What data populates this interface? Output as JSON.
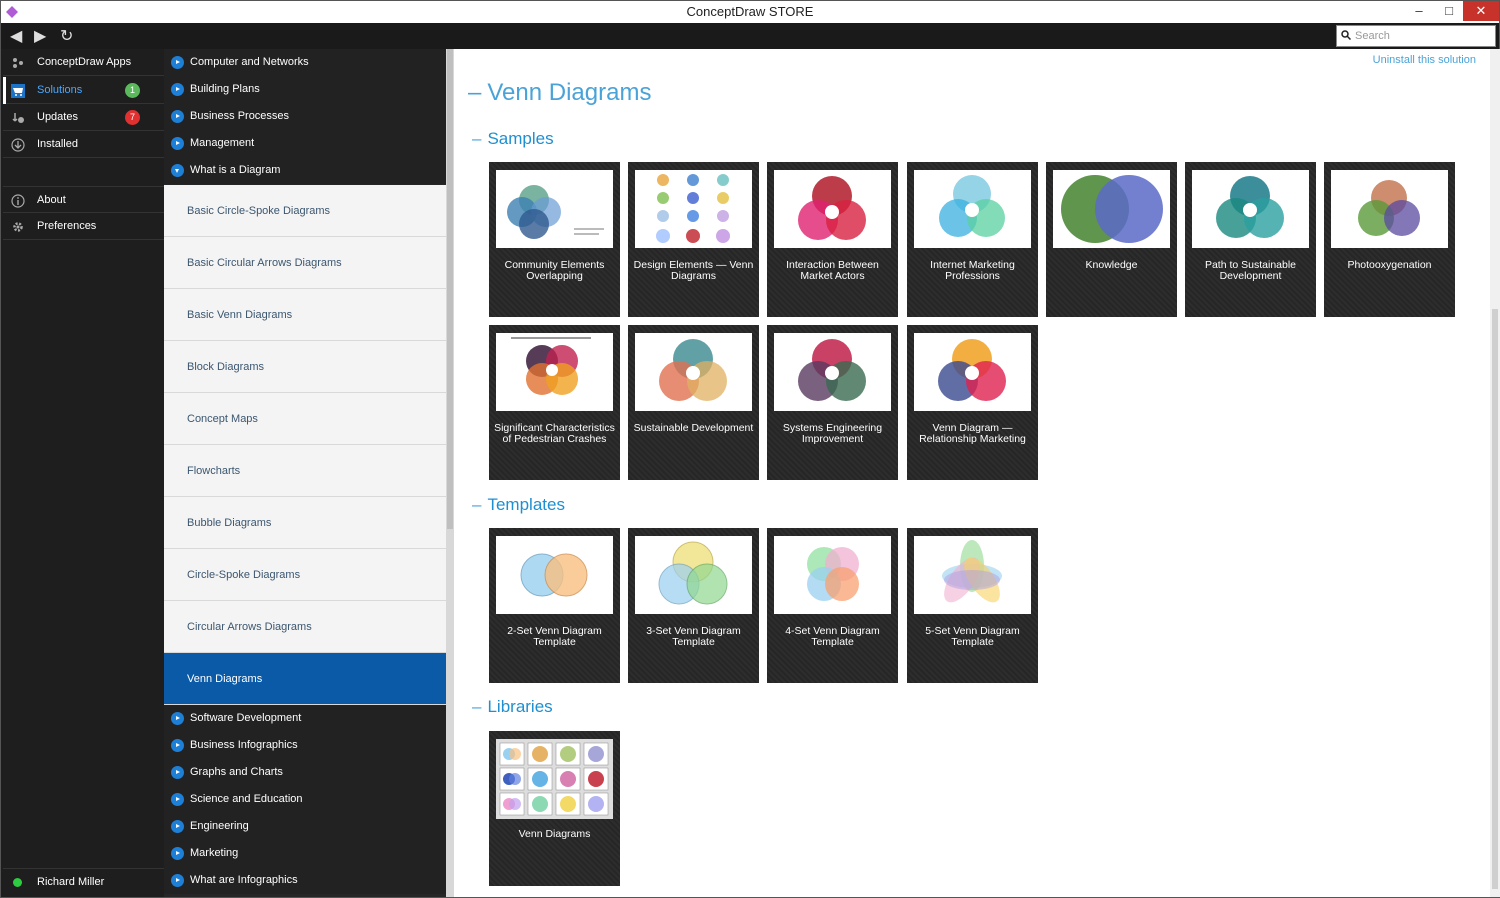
{
  "window": {
    "title": "ConceptDraw STORE",
    "minimize": "–",
    "maximize": "□",
    "close": "✕"
  },
  "toolbar": {
    "back": "◀",
    "forward": "▶",
    "refresh": "↻",
    "search_placeholder": "Search"
  },
  "leftnav": {
    "items": [
      {
        "label": "ConceptDraw Apps",
        "icon": "apps-icon"
      },
      {
        "label": "Solutions",
        "icon": "cart-icon",
        "badge": "1",
        "badge_color": "#5cb85c"
      },
      {
        "label": "Updates",
        "icon": "updates-icon",
        "badge": "7",
        "badge_color": "#e03030"
      },
      {
        "label": "Installed",
        "icon": "download-icon"
      },
      {
        "label": "About",
        "icon": "info-icon"
      },
      {
        "label": "Preferences",
        "icon": "gear-icon"
      }
    ],
    "user": "Richard Miller"
  },
  "categories_top": [
    "Computer and Networks",
    "Building Plans",
    "Business Processes",
    "Management",
    "What is a Diagram"
  ],
  "subitems": [
    "Basic Circle-Spoke Diagrams",
    "Basic Circular Arrows Diagrams",
    "Basic Venn Diagrams",
    "Block Diagrams",
    "Concept Maps",
    "Flowcharts",
    "Bubble Diagrams",
    "Circle-Spoke Diagrams",
    "Circular Arrows Diagrams",
    "Venn Diagrams"
  ],
  "categories_bottom": [
    "Software Development",
    "Business Infographics",
    "Graphs and Charts",
    "Science and Education",
    "Engineering",
    "Marketing",
    "What are Infographics"
  ],
  "content": {
    "uninstall": "Uninstall this solution",
    "title": "Venn Diagrams",
    "sections": {
      "samples": "Samples",
      "templates": "Templates",
      "libraries": "Libraries"
    },
    "samples": [
      "Community Elements Overlapping",
      "Design Elements — Venn Diagrams",
      "Interaction Between Market Actors",
      "Internet Marketing Professions",
      "Knowledge",
      "Path to Sustainable Development",
      "Photooxygenation",
      "Significant Characteristics of Pedestrian Crashes",
      "Sustainable Development",
      "Systems Engineering Improvement",
      "Venn Diagram — Relationship Marketing"
    ],
    "templates": [
      "2-Set Venn Diagram Template",
      "3-Set Venn Diagram Template",
      "4-Set Venn Diagram Template",
      "5-Set Venn Diagram Template"
    ],
    "libraries": [
      "Venn Diagrams"
    ]
  },
  "accent": "#1e8fd0",
  "selected_color": "#0a5aa8"
}
